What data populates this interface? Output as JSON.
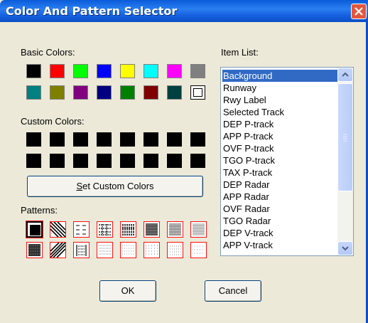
{
  "window": {
    "title": "Color And Pattern Selector"
  },
  "labels": {
    "basic_colors": "Basic Colors:",
    "custom_colors": "Custom Colors:",
    "patterns": "Patterns:",
    "item_list": "Item List:"
  },
  "basic_colors": [
    "#000000",
    "#ff0000",
    "#00ff00",
    "#0000ff",
    "#ffff00",
    "#00ffff",
    "#ff00ff",
    "#808080",
    "#008080",
    "#808000",
    "#800080",
    "#000080",
    "#008000",
    "#800000",
    "#004040",
    "#ffffff"
  ],
  "custom_colors": [
    "#000000",
    "#000000",
    "#000000",
    "#000000",
    "#000000",
    "#000000",
    "#000000",
    "#000000",
    "#000000",
    "#000000",
    "#000000",
    "#000000",
    "#000000",
    "#000000",
    "#000000",
    "#000000"
  ],
  "buttons": {
    "set_custom_colors_u": "S",
    "set_custom_colors_rest": "et Custom Colors",
    "ok": "OK",
    "cancel": "Cancel"
  },
  "item_list": [
    "Background",
    "Runway",
    "Rwy Label",
    "Selected Track",
    "DEP P-track",
    "APP P-track",
    "OVF P-track",
    "TGO P-track",
    "TAX P-track",
    "DEP Radar",
    "APP Radar",
    "OVF Radar",
    "TGO Radar",
    "DEP V-track",
    "APP V-track"
  ],
  "selected_item": "Background",
  "selected_pattern": 0,
  "colors": {
    "title_bar": "#0b4fc4",
    "selection": "#316ac5",
    "pattern_border": "#ff1010"
  }
}
